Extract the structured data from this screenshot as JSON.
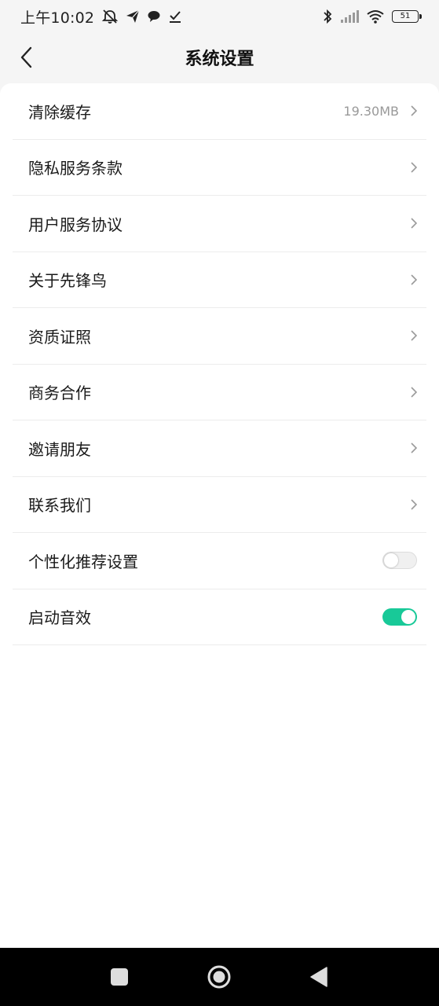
{
  "status_bar": {
    "time": "上午10:02",
    "battery_level": "51"
  },
  "header": {
    "title": "系统设置"
  },
  "settings": {
    "items": [
      {
        "label": "清除缓存",
        "value": "19.30MB"
      },
      {
        "label": "隐私服务条款"
      },
      {
        "label": "用户服务协议"
      },
      {
        "label": "关于先锋鸟"
      },
      {
        "label": "资质证照"
      },
      {
        "label": "商务合作"
      },
      {
        "label": "邀请朋友"
      },
      {
        "label": "联系我们"
      },
      {
        "label": "个性化推荐设置",
        "toggle": false
      },
      {
        "label": "启动音效",
        "toggle": true
      }
    ]
  },
  "colors": {
    "toggle_on": "#18c998",
    "toggle_off": "#f0f0f0"
  }
}
